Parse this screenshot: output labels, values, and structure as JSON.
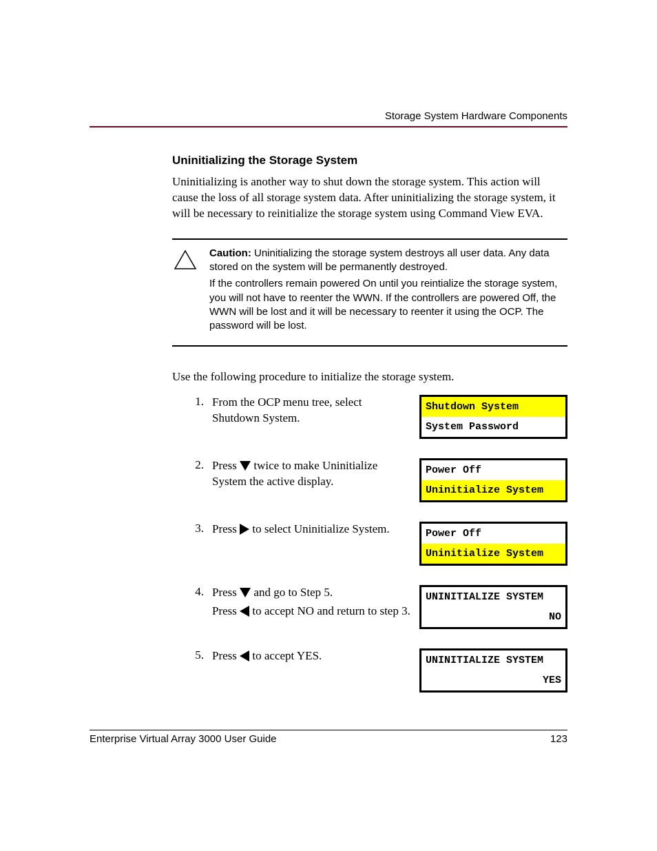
{
  "header": {
    "section_label": "Storage System Hardware Components"
  },
  "section": {
    "title": "Uninitializing the Storage System",
    "intro": "Uninitializing is another way to shut down the storage system. This action will cause the loss of all storage system data. After uninitializing the storage system, it will be necessary to reinitialize the storage system using Command View EVA."
  },
  "caution": {
    "label": "Caution:",
    "p1": "Uninitializing the storage system destroys all user data. Any data stored on the system will be permanently destroyed.",
    "p2": "If the controllers remain powered On until you reintialize the storage system, you will not have to reenter the WWN. If the controllers are powered Off, the WWN will be lost and it will be necessary to reenter it using the OCP. The password will be lost."
  },
  "lead": "Use the following procedure to initialize the storage system.",
  "steps": {
    "s1": {
      "num": "1.",
      "text": "From the OCP menu tree, select Shutdown System.",
      "ocp": {
        "l1": "Shutdown System",
        "l2": "System Password"
      }
    },
    "s2": {
      "num": "2.",
      "pre": "Press ",
      "post": " twice to make Uninitialize System the active display.",
      "ocp": {
        "l1": "Power Off",
        "l2": "Uninitialize System"
      }
    },
    "s3": {
      "num": "3.",
      "pre": "Press ",
      "post": " to select Uninitialize System.",
      "ocp": {
        "l1": "Power Off",
        "l2": "Uninitialize System"
      }
    },
    "s4": {
      "num": "4.",
      "l1_pre": "Press ",
      "l1_post": " and go to Step 5.",
      "l2_pre": "Press ",
      "l2_post": " to accept NO and return to step 3.",
      "ocp": {
        "l1": "UNINITIALIZE SYSTEM",
        "l2": "NO"
      }
    },
    "s5": {
      "num": "5.",
      "pre": "Press ",
      "post": " to accept YES.",
      "ocp": {
        "l1": "UNINITIALIZE SYSTEM",
        "l2": "YES"
      }
    }
  },
  "footer": {
    "doc_title": "Enterprise Virtual Array 3000 User Guide",
    "page_num": "123"
  }
}
